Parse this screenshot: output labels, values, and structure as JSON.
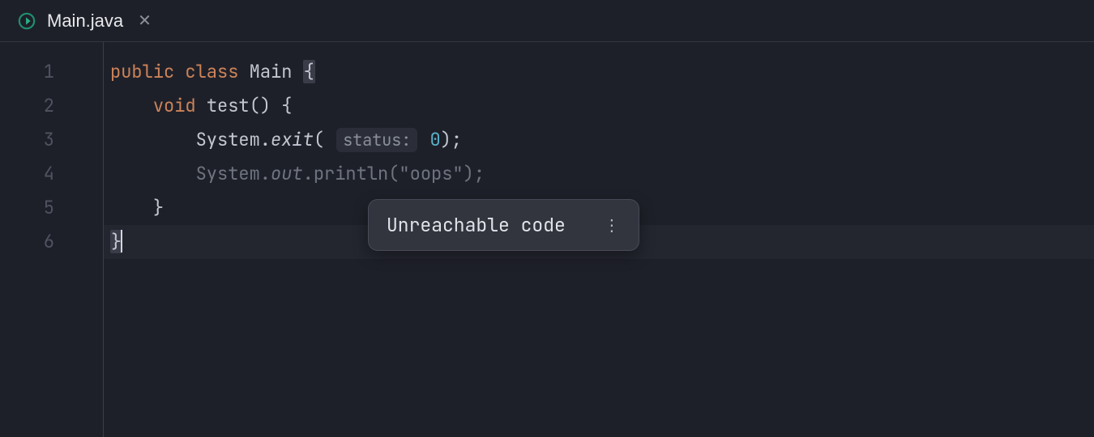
{
  "tab": {
    "filename": "Main.java",
    "close_glyph": "✕"
  },
  "gutter": {
    "lines": [
      "1",
      "2",
      "3",
      "4",
      "5",
      "6"
    ]
  },
  "code": {
    "l1": {
      "kw_public": "public",
      "kw_class": "class",
      "cls": "Main",
      "brace": "{"
    },
    "l2": {
      "kw_void": "void",
      "fn": "test",
      "parens": "()",
      "brace": " {"
    },
    "l3": {
      "sys": "System.",
      "exit": "exit",
      "open": "(",
      "hint": "status:",
      "num": "0",
      "close": ");"
    },
    "l4": {
      "sys": "System.",
      "out": "out",
      "tail": ".println(\"oops\");"
    },
    "l5": {
      "brace": "}"
    },
    "l6": {
      "brace": "}"
    }
  },
  "tooltip": {
    "message": "Unreachable code",
    "more_glyph": "⋮"
  }
}
